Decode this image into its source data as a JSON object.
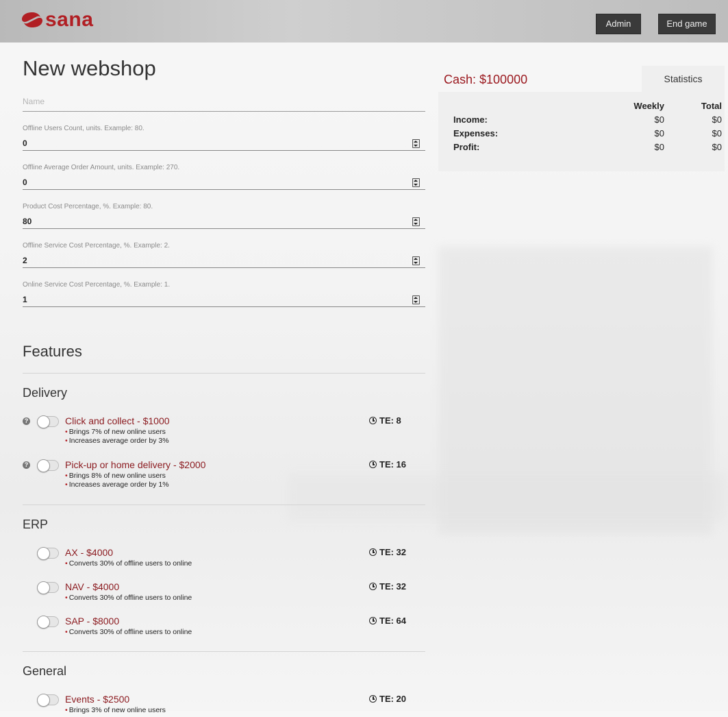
{
  "header": {
    "logo_text": "sana",
    "admin_label": "Admin",
    "end_game_label": "End game",
    "brand_color": "#b11f24"
  },
  "form": {
    "title": "New webshop",
    "name_placeholder": "Name",
    "fields": [
      {
        "label": "Offline Users Count, units. Example: 80.",
        "value": "0"
      },
      {
        "label": "Offline Average Order Amount, units. Example: 270.",
        "value": "0"
      },
      {
        "label": "Product Cost Percentage, %. Example: 80.",
        "value": "80"
      },
      {
        "label": "Offline Service Cost Percentage, %. Example: 2.",
        "value": "2"
      },
      {
        "label": "Online Service Cost Percentage, %. Example: 1.",
        "value": "1"
      }
    ]
  },
  "features": {
    "title": "Features",
    "groups": [
      {
        "name": "Delivery",
        "items": [
          {
            "title": "Click and collect - $1000",
            "te": "TE: 8",
            "bullets": [
              "Brings 7% of new online users",
              "Increases average order by 3%"
            ],
            "enabled": false,
            "help_icon": "question-circle-icon"
          },
          {
            "title": "Pick-up or home delivery - $2000",
            "te": "TE: 16",
            "bullets": [
              "Brings 8% of new online users",
              "Increases average order by 1%"
            ],
            "enabled": false,
            "help_icon": "question-circle-icon"
          }
        ]
      },
      {
        "name": "ERP",
        "items": [
          {
            "title": "AX - $4000",
            "te": "TE: 32",
            "bullets": [
              "Converts 30% of offline users to online"
            ],
            "enabled": false
          },
          {
            "title": "NAV - $4000",
            "te": "TE: 32",
            "bullets": [
              "Converts 30% of offline users to online"
            ],
            "enabled": false
          },
          {
            "title": "SAP - $8000",
            "te": "TE: 64",
            "bullets": [
              "Converts 30% of offline users to online"
            ],
            "enabled": false
          }
        ]
      },
      {
        "name": "General",
        "items": [
          {
            "title": "Events - $2500",
            "te": "TE: 20",
            "bullets": [
              "Brings 3% of new online users"
            ],
            "enabled": false
          }
        ]
      }
    ]
  },
  "stats": {
    "cash": "Cash: $100000",
    "tab_label": "Statistics",
    "col_weekly": "Weekly",
    "col_total": "Total",
    "rows": [
      {
        "label": "Income:",
        "weekly": "$0",
        "total": "$0"
      },
      {
        "label": "Expenses:",
        "weekly": "$0",
        "total": "$0"
      },
      {
        "label": "Profit:",
        "weekly": "$0",
        "total": "$0"
      }
    ]
  }
}
